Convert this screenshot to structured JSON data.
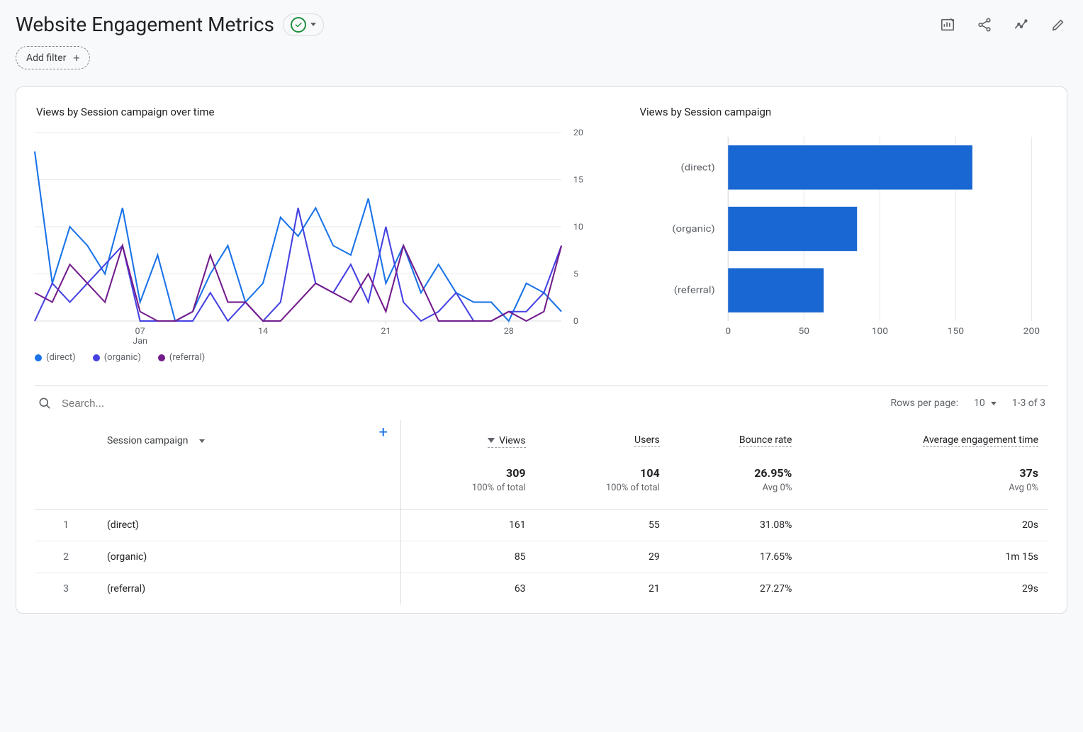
{
  "header": {
    "title": "Website Engagement Metrics",
    "add_filter_label": "Add filter"
  },
  "chart_left_title": "Views by Session campaign over time",
  "chart_right_title": "Views by Session campaign",
  "legend": {
    "direct": "(direct)",
    "organic": "(organic)",
    "referral": "(referral)"
  },
  "colors": {
    "direct": "#1a73e8",
    "organic": "#4642e2",
    "referral": "#731c8c",
    "bar": "#1967d2"
  },
  "table": {
    "search_placeholder": "Search...",
    "rows_per_page_label": "Rows per page:",
    "rows_per_page_value": "10",
    "range_label": "1-3 of 3",
    "dimension_label": "Session campaign",
    "columns": {
      "views": "Views",
      "users": "Users",
      "bounce": "Bounce rate",
      "aet": "Average engagement time"
    },
    "totals": {
      "views": "309",
      "views_sub": "100% of total",
      "users": "104",
      "users_sub": "100% of total",
      "bounce": "26.95%",
      "bounce_sub": "Avg 0%",
      "aet": "37s",
      "aet_sub": "Avg 0%"
    },
    "rows": [
      {
        "idx": "1",
        "name": "(direct)",
        "views": "161",
        "users": "55",
        "bounce": "31.08%",
        "aet": "20s"
      },
      {
        "idx": "2",
        "name": "(organic)",
        "views": "85",
        "users": "29",
        "bounce": "17.65%",
        "aet": "1m 15s"
      },
      {
        "idx": "3",
        "name": "(referral)",
        "views": "63",
        "users": "21",
        "bounce": "27.27%",
        "aet": "29s"
      }
    ]
  },
  "chart_data": [
    {
      "type": "line",
      "title": "Views by Session campaign over time",
      "xlabel": "Jan",
      "ylabel": "",
      "ylim": [
        0,
        20
      ],
      "yticks": [
        0,
        5,
        10,
        15,
        20
      ],
      "xticks_major": [
        "07",
        "14",
        "21",
        "28"
      ],
      "x_days": [
        1,
        2,
        3,
        4,
        5,
        6,
        7,
        8,
        9,
        10,
        11,
        12,
        13,
        14,
        15,
        16,
        17,
        18,
        19,
        20,
        21,
        22,
        23,
        24,
        25,
        26,
        27,
        28,
        29,
        30,
        31
      ],
      "series": [
        {
          "name": "(direct)",
          "color": "#1a73e8",
          "values": [
            18,
            4,
            10,
            8,
            5,
            12,
            2,
            7,
            0,
            1,
            5,
            8,
            2,
            4,
            11,
            9,
            12,
            8,
            7,
            13,
            4,
            8,
            3,
            6,
            3,
            2,
            2,
            0,
            4,
            3,
            1
          ]
        },
        {
          "name": "(organic)",
          "color": "#4642e2",
          "values": [
            0,
            4,
            2,
            4,
            6,
            8,
            0,
            0,
            0,
            0,
            3,
            0,
            2,
            0,
            2,
            12,
            4,
            3,
            6,
            2,
            10,
            2,
            0,
            1,
            3,
            0,
            0,
            1,
            1,
            3,
            8
          ]
        },
        {
          "name": "(referral)",
          "color": "#731c8c",
          "values": [
            3,
            2,
            6,
            4,
            2,
            8,
            1,
            0,
            0,
            1,
            7,
            2,
            2,
            0,
            0,
            2,
            4,
            3,
            2,
            5,
            1,
            8,
            4,
            0,
            0,
            0,
            0,
            1,
            0,
            1,
            8
          ]
        }
      ]
    },
    {
      "type": "bar",
      "orientation": "horizontal",
      "title": "Views by Session campaign",
      "xlabel": "",
      "ylabel": "",
      "xlim": [
        0,
        200
      ],
      "xticks": [
        0,
        50,
        100,
        150,
        200
      ],
      "categories": [
        "(direct)",
        "(organic)",
        "(referral)"
      ],
      "values": [
        161,
        85,
        63
      ]
    }
  ]
}
